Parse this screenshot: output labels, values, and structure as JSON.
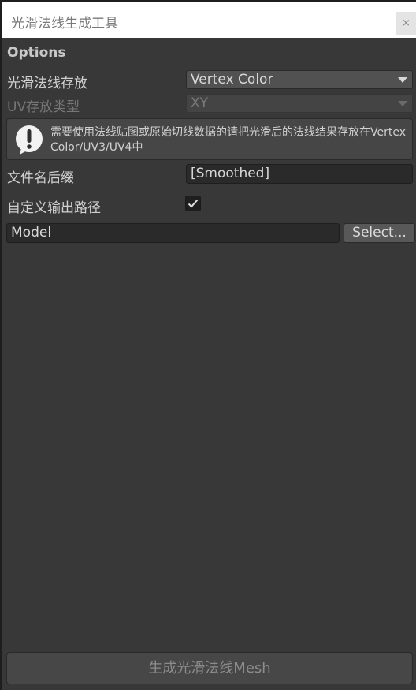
{
  "window": {
    "title": "光滑法线生成工具",
    "close_glyph": "×"
  },
  "options": {
    "header": "Options",
    "storage_label": "光滑法线存放",
    "storage_value": "Vertex Color",
    "uv_type_label": "UV存放类型",
    "uv_type_value": "XY",
    "help_text": "需要使用法线贴图或原始切线数据的请把光滑后的法线结果存放在VertexColor/UV3/UV4中",
    "help_icon": "warning-icon",
    "suffix_label": "文件名后缀",
    "suffix_value": "[Smoothed]",
    "custom_path_label": "自定义输出路径",
    "custom_path_checked": true,
    "path_value": "Model",
    "select_label": "Select...",
    "generate_label": "生成光滑法线Mesh"
  },
  "colors": {
    "panel_bg": "#383838",
    "field_bg": "#2a2a2a",
    "dropdown_bg": "#515151"
  }
}
